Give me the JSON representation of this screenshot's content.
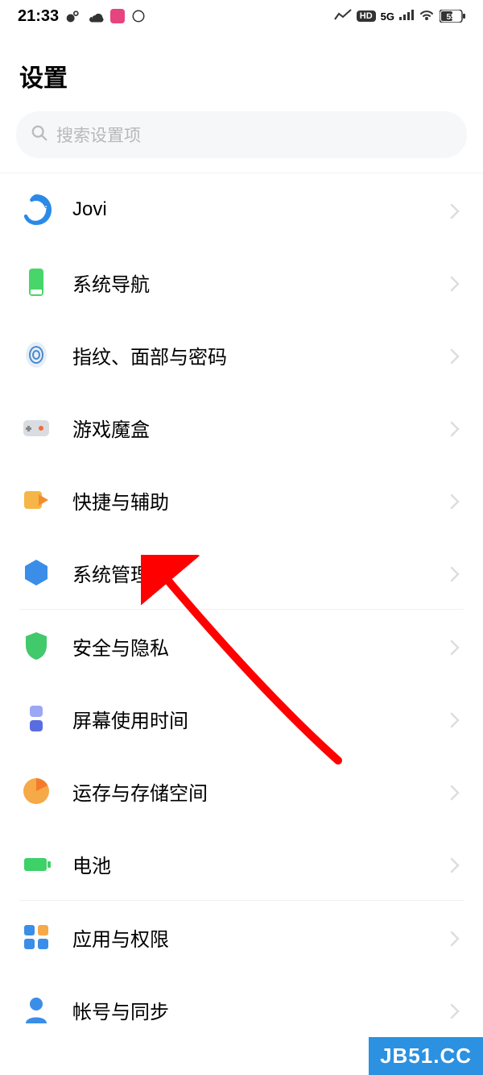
{
  "statusbar": {
    "time": "21:33",
    "network": "5G",
    "hd": "HD",
    "battery": "55"
  },
  "title": "设置",
  "search": {
    "placeholder": "搜索设置项"
  },
  "items": {
    "jovi": "Jovi",
    "navigation": "系统导航",
    "biometric": "指纹、面部与密码",
    "gamebox": "游戏魔盒",
    "shortcut": "快捷与辅助",
    "sysmgmt": "系统管理",
    "security": "安全与隐私",
    "screentime": "屏幕使用时间",
    "storage": "运存与存储空间",
    "battery": "电池",
    "apps": "应用与权限",
    "account": "帐号与同步"
  },
  "watermark": "JB51.CC"
}
